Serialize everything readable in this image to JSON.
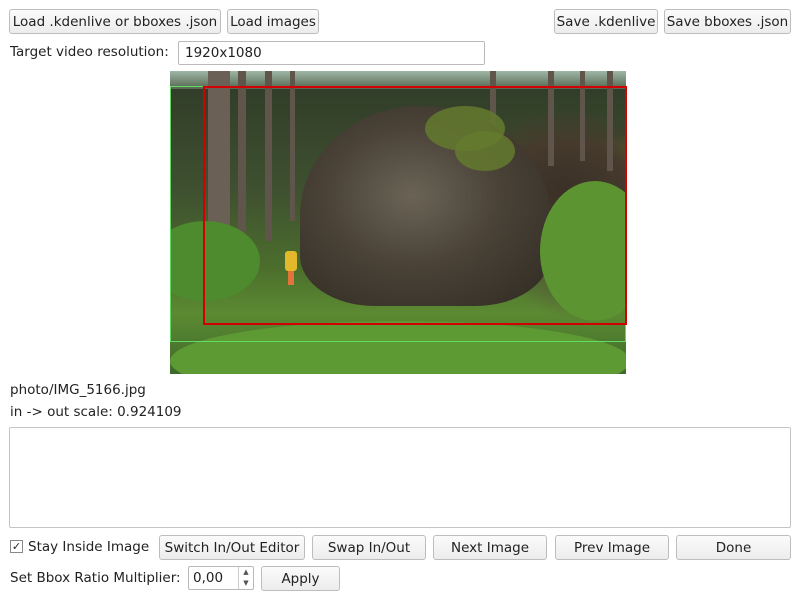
{
  "toolbar": {
    "load_kdenlive_label": "Load .kdenlive or bboxes .json",
    "load_images_label": "Load images",
    "save_kdenlive_label": "Save .kdenlive",
    "save_bboxes_label": "Save bboxes .json"
  },
  "resolution": {
    "label": "Target video resolution:",
    "value": "1920x1080"
  },
  "image": {
    "filename": "photo/IMG_5166.jpg",
    "scale_text": "in -> out scale: 0.924109",
    "in_box_color": "#64d964",
    "out_box_color": "#d20000"
  },
  "notes": {
    "value": ""
  },
  "controls": {
    "stay_inside_label": "Stay Inside Image",
    "stay_inside_checked": true,
    "switch_editor_label": "Switch In/Out Editor",
    "swap_label": "Swap In/Out",
    "next_label": "Next Image",
    "prev_label": "Prev Image",
    "done_label": "Done"
  },
  "ratio": {
    "label": "Set Bbox Ratio Multiplier:",
    "value": "0,00",
    "apply_label": "Apply"
  }
}
